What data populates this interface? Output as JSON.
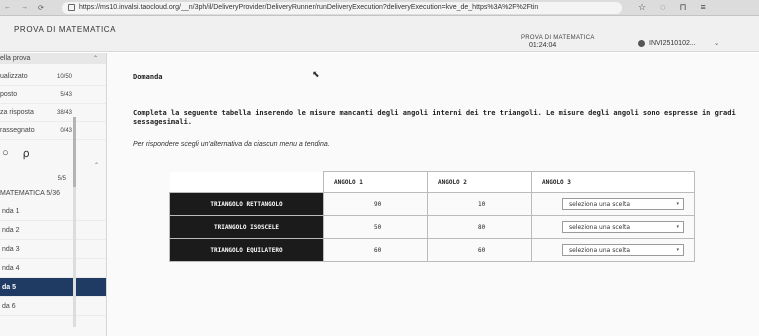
{
  "browser": {
    "url": "https://ms10.invalsi.taocloud.org/__n/3ph/il/DeliveryProvider/DeliveryRunner/runDeliveryExecution?deliveryExecution=kve_de_https%3A%2F%2Ftin",
    "nav_glyphs": [
      "←",
      "→",
      "⟳"
    ]
  },
  "header": {
    "app_title": "PROVA DI MATEMATICA",
    "section_title": "PROVA DI MATEMATICA",
    "timer": "01:24:04",
    "user": "INVI2510102..."
  },
  "sidebar": {
    "head_label": "ella prova",
    "stats": [
      {
        "label": "ualizzato",
        "value": "10/50"
      },
      {
        "label": "posto",
        "value": "5/43"
      },
      {
        "label": "za risposta",
        "value": "38/43"
      },
      {
        "label": "rassegnato",
        "value": "0/43"
      }
    ],
    "tools": [
      "○",
      "⍴"
    ],
    "scroll_up": "⌃",
    "section_count": "5/5",
    "section_label": "MATEMATICA 5/36",
    "items": [
      "nda 1",
      "nda 2",
      "nda 3",
      "nda 4",
      "da 5",
      "da 6"
    ],
    "active_index": 4,
    "collapse_glyph": "‹"
  },
  "main": {
    "domanda_label": "Domanda",
    "cursor_glyph": "⬉",
    "instruction_line1": "Completa la seguente tabella inserendo le misure mancanti degli angoli interni dei tre triangoli. Le misure degli angoli sono espresse in gradi",
    "instruction_line2": "sessagesimali.",
    "hint": "Per rispondere scegli un'alternativa da ciascun menu a tendina.",
    "table": {
      "headers": [
        "ANGOLO 1",
        "ANGOLO 2",
        "ANGOLO 3"
      ],
      "rows": [
        {
          "name": "TRIANGOLO RETTANGOLO",
          "a1": "90",
          "a2": "10",
          "select": "seleziona una scelta"
        },
        {
          "name": "TRIANGOLO ISOSCELE",
          "a1": "50",
          "a2": "80",
          "select": "seleziona una scelta"
        },
        {
          "name": "TRIANGOLO EQUILATERO",
          "a1": "60",
          "a2": "60",
          "select": "seleziona una scelta"
        }
      ],
      "select_arrow": "▾"
    }
  }
}
